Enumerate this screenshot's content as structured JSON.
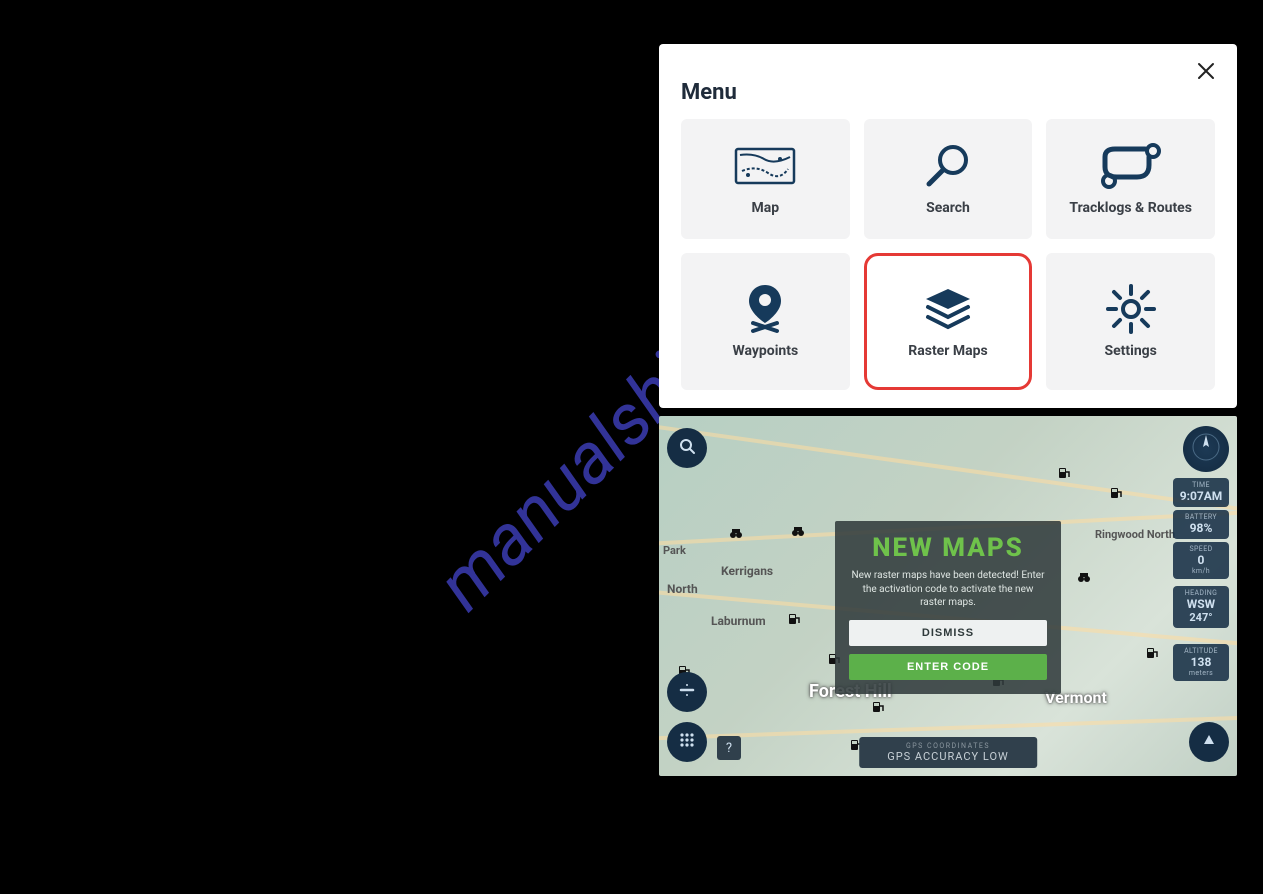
{
  "watermark_text": "manualshive.com",
  "menu": {
    "title": "Menu",
    "tiles": [
      {
        "label": "Map",
        "icon": "map-icon"
      },
      {
        "label": "Search",
        "icon": "search-icon"
      },
      {
        "label": "Tracklogs & Routes",
        "icon": "route-icon"
      },
      {
        "label": "Waypoints",
        "icon": "waypoint-icon"
      },
      {
        "label": "Raster Maps",
        "icon": "layers-icon",
        "highlight": true
      },
      {
        "label": "Settings",
        "icon": "gear-icon"
      }
    ]
  },
  "map": {
    "places": {
      "forest_hill": "Forest Hill",
      "vermont": "Vermont",
      "laburnum": "Laburnum",
      "kerrigans": "Kerrigans",
      "north": "North",
      "park": "Park",
      "ringwood_north": "Ringwood North"
    },
    "stats": {
      "time": {
        "label": "TIME",
        "value": "9:07AM"
      },
      "battery": {
        "label": "BATTERY",
        "value": "98%"
      },
      "speed": {
        "label": "SPEED",
        "value": "0",
        "unit": "km/h"
      },
      "heading": {
        "label": "HEADING",
        "value": "WSW",
        "unit": "247°"
      },
      "altitude": {
        "label": "ALTITUDE",
        "value": "138",
        "unit": "meters"
      }
    },
    "accuracy": {
      "label": "GPS COORDINATES",
      "value": "GPS ACCURACY LOW"
    },
    "help_label": "?",
    "dialog": {
      "title": "NEW MAPS",
      "body": "New raster maps have been detected! Enter the activation code to activate the new raster maps.",
      "dismiss": "DISMISS",
      "enter": "ENTER CODE"
    }
  }
}
